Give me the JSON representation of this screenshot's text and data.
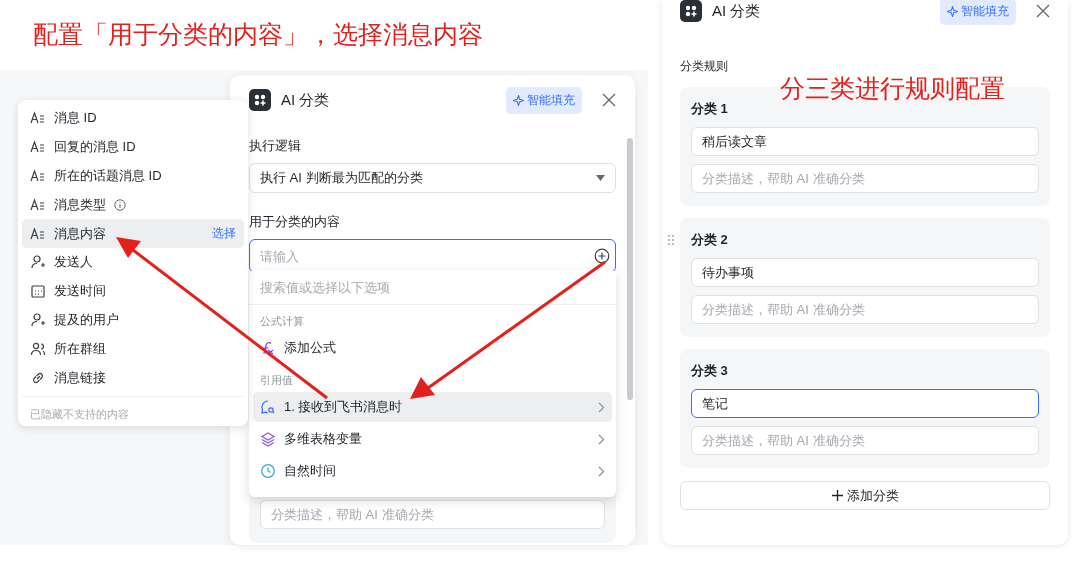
{
  "annotations": [
    {
      "text": "配置「用于分类的内容」，选择消息内容"
    },
    {
      "text": "分三类进行规则配置"
    }
  ],
  "field_menu": {
    "items": [
      {
        "label": "消息 ID",
        "kind": "text",
        "info": false,
        "selected": false
      },
      {
        "label": "回复的消息 ID",
        "kind": "text",
        "info": false,
        "selected": false
      },
      {
        "label": "所在的话题消息 ID",
        "kind": "text",
        "info": false,
        "selected": false
      },
      {
        "label": "消息类型",
        "kind": "text",
        "info": true,
        "selected": false
      },
      {
        "label": "消息内容",
        "kind": "text",
        "info": false,
        "selected": true
      },
      {
        "label": "发送人",
        "kind": "person",
        "info": false,
        "selected": false
      },
      {
        "label": "发送时间",
        "kind": "date",
        "info": false,
        "selected": false
      },
      {
        "label": "提及的用户",
        "kind": "person",
        "info": false,
        "selected": false
      },
      {
        "label": "所在群组",
        "kind": "group",
        "info": false,
        "selected": false
      },
      {
        "label": "消息链接",
        "kind": "link",
        "info": false,
        "selected": false
      }
    ],
    "action": "选择",
    "footer": "已隐藏不支持的内容"
  },
  "config_panel": {
    "title": "AI 分类",
    "smart_fill": "智能填充",
    "logic_label": "执行逻辑",
    "logic_value": "执行 AI 判断最为匹配的分类",
    "content_label": "用于分类的内容",
    "content_placeholder": "请输入",
    "dropdown": {
      "search_placeholder": "搜索值或选择以下选项",
      "groups": [
        {
          "heading": "公式计算",
          "items": [
            {
              "label": "添加公式",
              "kind": "formula",
              "selected": false,
              "submenu": false
            }
          ]
        },
        {
          "heading": "引用值",
          "items": [
            {
              "label": "1. 接收到飞书消息时",
              "kind": "message",
              "selected": true,
              "submenu": true
            },
            {
              "label": "多维表格变量",
              "kind": "layers",
              "selected": false,
              "submenu": true
            },
            {
              "label": "自然时间",
              "kind": "clock",
              "selected": false,
              "submenu": true
            }
          ]
        }
      ]
    },
    "description_placeholder": "分类描述，帮助 AI 准确分类"
  },
  "rules_panel": {
    "title": "AI 分类",
    "smart_fill": "智能填充",
    "section_label": "分类规则",
    "categories": [
      {
        "name": "分类 1",
        "value": "稍后读文章",
        "placeholder": "分类描述，帮助 AI 准确分类",
        "focused": false,
        "drag_handle": false
      },
      {
        "name": "分类 2",
        "value": "待办事项",
        "placeholder": "分类描述，帮助 AI 准确分类",
        "focused": false,
        "drag_handle": true
      },
      {
        "name": "分类 3",
        "value": "笔记",
        "placeholder": "分类描述，帮助 AI 准确分类",
        "focused": true,
        "drag_handle": false
      }
    ],
    "add_button": "添加分类"
  }
}
